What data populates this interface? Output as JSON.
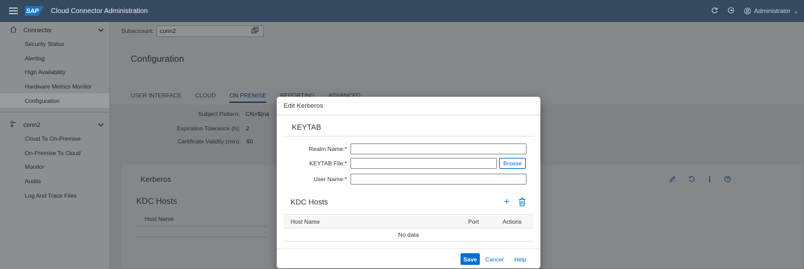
{
  "shell": {
    "logo": "SAP",
    "title": "Cloud Connector Administration",
    "user": "Administrator"
  },
  "sidebar": {
    "connector_group": "Connector",
    "connector_items": [
      {
        "label": "Security Status"
      },
      {
        "label": "Alerting"
      },
      {
        "label": "High Availability"
      },
      {
        "label": "Hardware Metrics Monitor"
      },
      {
        "label": "Configuration"
      }
    ],
    "subaccount_group": "conn2",
    "subaccount_items": [
      {
        "label": "Cloud To On-Premise"
      },
      {
        "label": "On-Premise To Cloud"
      },
      {
        "label": "Monitor"
      },
      {
        "label": "Audits"
      },
      {
        "label": "Log And Trace Files"
      }
    ]
  },
  "subaccount": {
    "label": "Subaccount:",
    "value": "conn2"
  },
  "page": {
    "title": "Configuration",
    "tabs": [
      {
        "label": "USER INTERFACE"
      },
      {
        "label": "CLOUD"
      },
      {
        "label": "ON PREMISE"
      },
      {
        "label": "REPORTING"
      },
      {
        "label": "ADVANCED"
      }
    ],
    "fields": [
      {
        "label": "Subject Pattern:",
        "value": "CN=${na"
      },
      {
        "label": "Expiration Tolerance (h):",
        "value": "2"
      },
      {
        "label": "Certificate Validity (min):",
        "value": "60"
      }
    ],
    "kerberos_title": "Kerberos",
    "kdc_title": "KDC Hosts",
    "host_name_col": "Host Name"
  },
  "dialog": {
    "title": "Edit Kerberos",
    "keytab_section": "KEYTAB",
    "realm_label": "Realm Name:",
    "keytab_label": "KEYTAB File:",
    "user_label": "User Name:",
    "required_mark": "*",
    "realm_value": "",
    "keytab_value": "",
    "user_value": "",
    "browse_label": "Browse",
    "kdc_section": "KDC Hosts",
    "columns": {
      "host": "Host Name",
      "port": "Port",
      "actions": "Actions"
    },
    "no_data": "No data",
    "save_label": "Save",
    "cancel_label": "Cancel",
    "help_label": "Help"
  },
  "colors": {
    "shell": "#354a5f",
    "accent": "#0a6ed1",
    "required": "#bb0000"
  }
}
